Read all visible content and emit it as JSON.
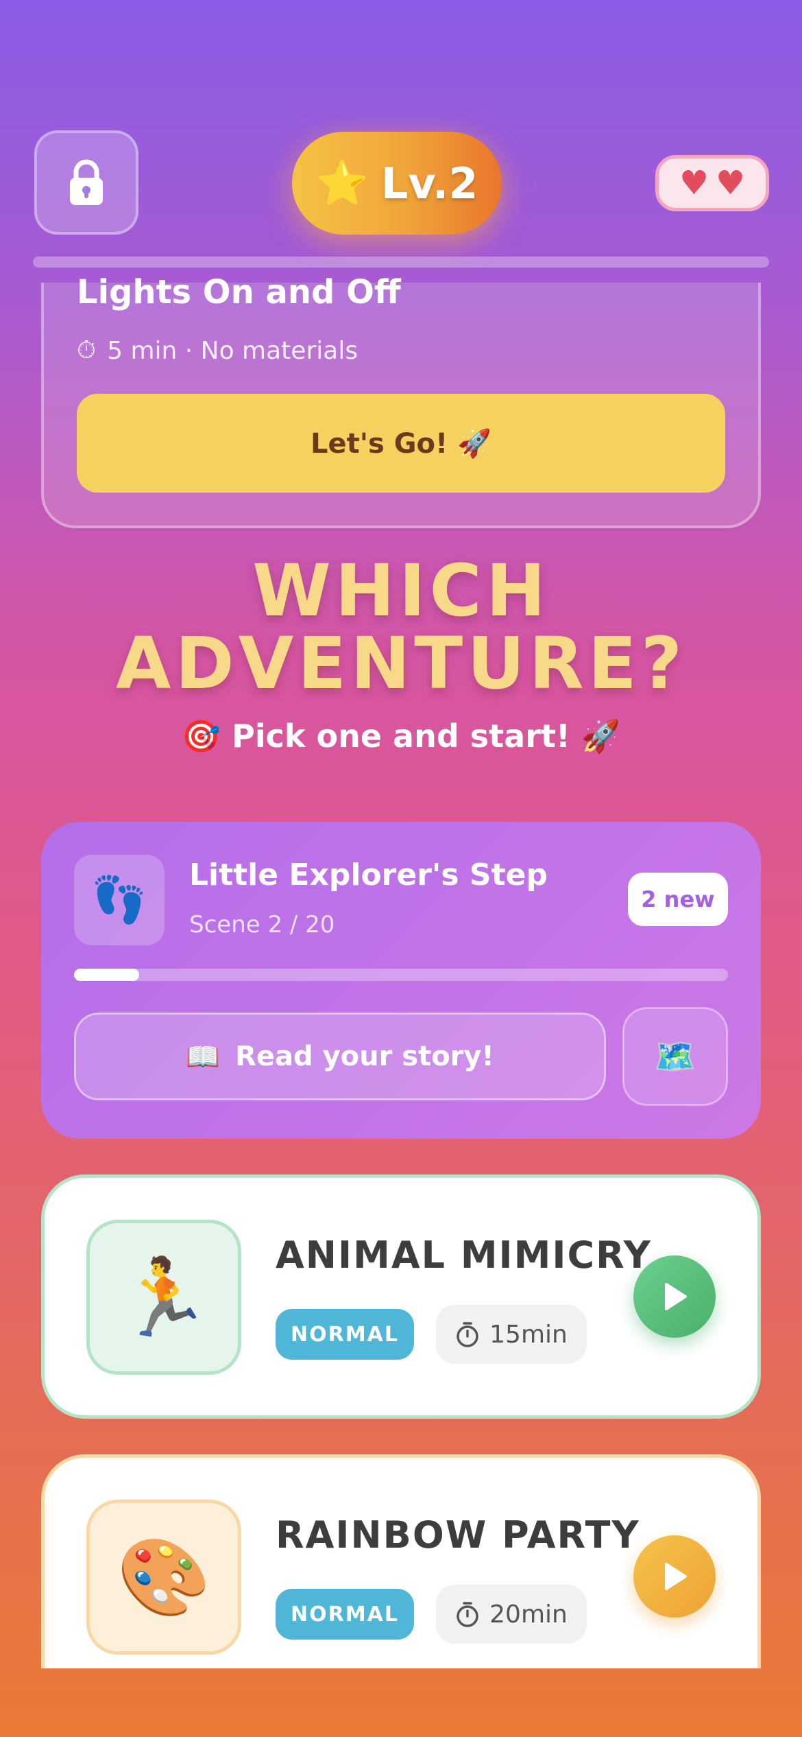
{
  "header": {
    "lock_icon": "lock-icon",
    "level_star": "⭐",
    "level_label": "Lv.2",
    "hearts": [
      "♥",
      "♥"
    ]
  },
  "current_activity": {
    "title": "Lights On and Off",
    "meta_icon": "⏱",
    "meta": "5 min · No materials",
    "cta": "Let's Go! 🚀"
  },
  "heading": {
    "line1": "WHICH",
    "line2": "ADVENTURE?",
    "subtitle": "🎯  Pick one and start! 🚀"
  },
  "explorer": {
    "icon": "👣",
    "title": "Little Explorer's Step",
    "scene": "Scene 2 / 20",
    "progress_fraction": 0.1,
    "badge": "2 new",
    "read_icon": "📖",
    "read_label": "Read your story!",
    "map_icon": "🗺️"
  },
  "games": [
    {
      "emoji": "🏃",
      "title": "ANIMAL MIMICRY",
      "difficulty": "NORMAL",
      "time": "15min",
      "accent": "#49b06a"
    },
    {
      "emoji": "🎨",
      "title": "RAINBOW PARTY",
      "difficulty": "NORMAL",
      "time": "20min",
      "accent": "#eda236"
    }
  ]
}
